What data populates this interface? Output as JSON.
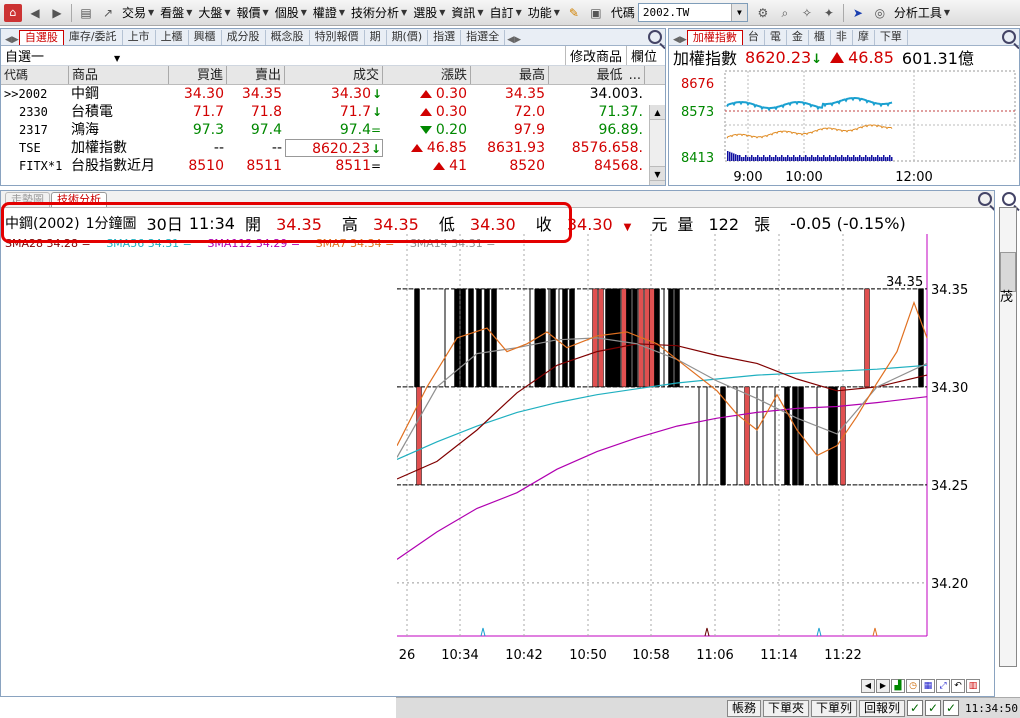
{
  "toolbar": {
    "menus": [
      "交易",
      "看盤",
      "大盤",
      "報價",
      "個股",
      "權證",
      "技術分析",
      "選股",
      "資訊",
      "自訂",
      "功能"
    ],
    "code_label": "代碼",
    "code_value": "2002.TW",
    "analysis_tools": "分析工具"
  },
  "watchlist": {
    "tabs": [
      "自選股",
      "庫存/委託",
      "上市",
      "上櫃",
      "興櫃",
      "成分股",
      "概念股",
      "特別報價",
      "期",
      "期(價)",
      "指選",
      "指選全"
    ],
    "group_name": "自選一",
    "actions": [
      "修改商品",
      "欄位"
    ],
    "columns": [
      "代碼",
      "商品",
      "買進",
      "賣出",
      "成交",
      "漲跌",
      "最高",
      "最低",
      "..."
    ],
    "rows": [
      {
        "code": ">>2002",
        "name": "中鋼",
        "bid": "34.30",
        "ask": "34.35",
        "last": "34.30",
        "chg": "0.30",
        "high": "34.35",
        "low": "34.003."
      },
      {
        "code": "2330",
        "name": "台積電",
        "bid": "71.7",
        "ask": "71.8",
        "last": "71.7",
        "chg": "0.30",
        "high": "72.0",
        "low": "71.37."
      },
      {
        "code": "2317",
        "name": "鴻海",
        "bid": "97.3",
        "ask": "97.4",
        "last": "97.4",
        "chg": "0.20",
        "high": "97.9",
        "low": "96.89."
      },
      {
        "code": "TSE",
        "name": "加權指數",
        "bid": "--",
        "ask": "--",
        "last": "8620.23",
        "chg": "46.85",
        "high": "8631.93",
        "low": "8576.658."
      },
      {
        "code": "FITX*1",
        "name": "台股指數近月",
        "bid": "8510",
        "ask": "8511",
        "last": "8511",
        "chg": "41",
        "high": "8520",
        "low": "84568."
      }
    ],
    "eq_sign": "="
  },
  "index_panel": {
    "tabs": [
      "加權指數",
      "台",
      "電",
      "金",
      "櫃",
      "非",
      "摩",
      "下單"
    ],
    "name": "加權指數",
    "value": "8620.23",
    "change": "46.85",
    "volume": "601.31億",
    "chart_data": {
      "type": "line",
      "y_labels": [
        "8676",
        "8573",
        "8413"
      ],
      "x_labels": [
        "9:00",
        "10:00",
        "12:00"
      ],
      "reference": 8573
    }
  },
  "chart_panel": {
    "tabs": [
      "走勢圖",
      "技術分析"
    ],
    "quote": {
      "name": "中鋼(2002)",
      "period": "1分鐘圖",
      "date": "30日",
      "time": "11:34",
      "open_label": "開",
      "open": "34.35",
      "high_label": "高",
      "high": "34.35",
      "low_label": "低",
      "low": "34.30",
      "close_label": "收",
      "close": "34.30",
      "unit": "元",
      "vol_label": "量",
      "vol": "122",
      "vol_unit": "張",
      "change": "-0.05 (-0.15%)"
    },
    "ma": [
      "SMA28 34.28 =",
      "SMA56 34.31 =",
      "SMA112 34.29 =",
      "SMA7 34.34 =",
      "SMA14 34.31 ="
    ],
    "side_char": "茂",
    "chart_data": {
      "type": "bar",
      "x_labels": [
        "26",
        "10:34",
        "10:42",
        "10:50",
        "10:58",
        "11:06",
        "11:14",
        "11:22"
      ],
      "y_labels": [
        "34.35",
        "34.30",
        "34.25",
        "34.20"
      ],
      "ylim": [
        34.178,
        34.378
      ],
      "last_label": "34.35",
      "colors": {
        "up": "#e05050",
        "down": "#000000",
        "ma28": "#800000",
        "ma56": "#20b0c0",
        "ma112": "#b000b0",
        "ma7": "#e07020",
        "ma14": "#909090"
      }
    }
  },
  "statusbar": {
    "buttons": [
      "帳務",
      "下單夾",
      "下單列",
      "回報列"
    ],
    "time": "11:34:50"
  }
}
